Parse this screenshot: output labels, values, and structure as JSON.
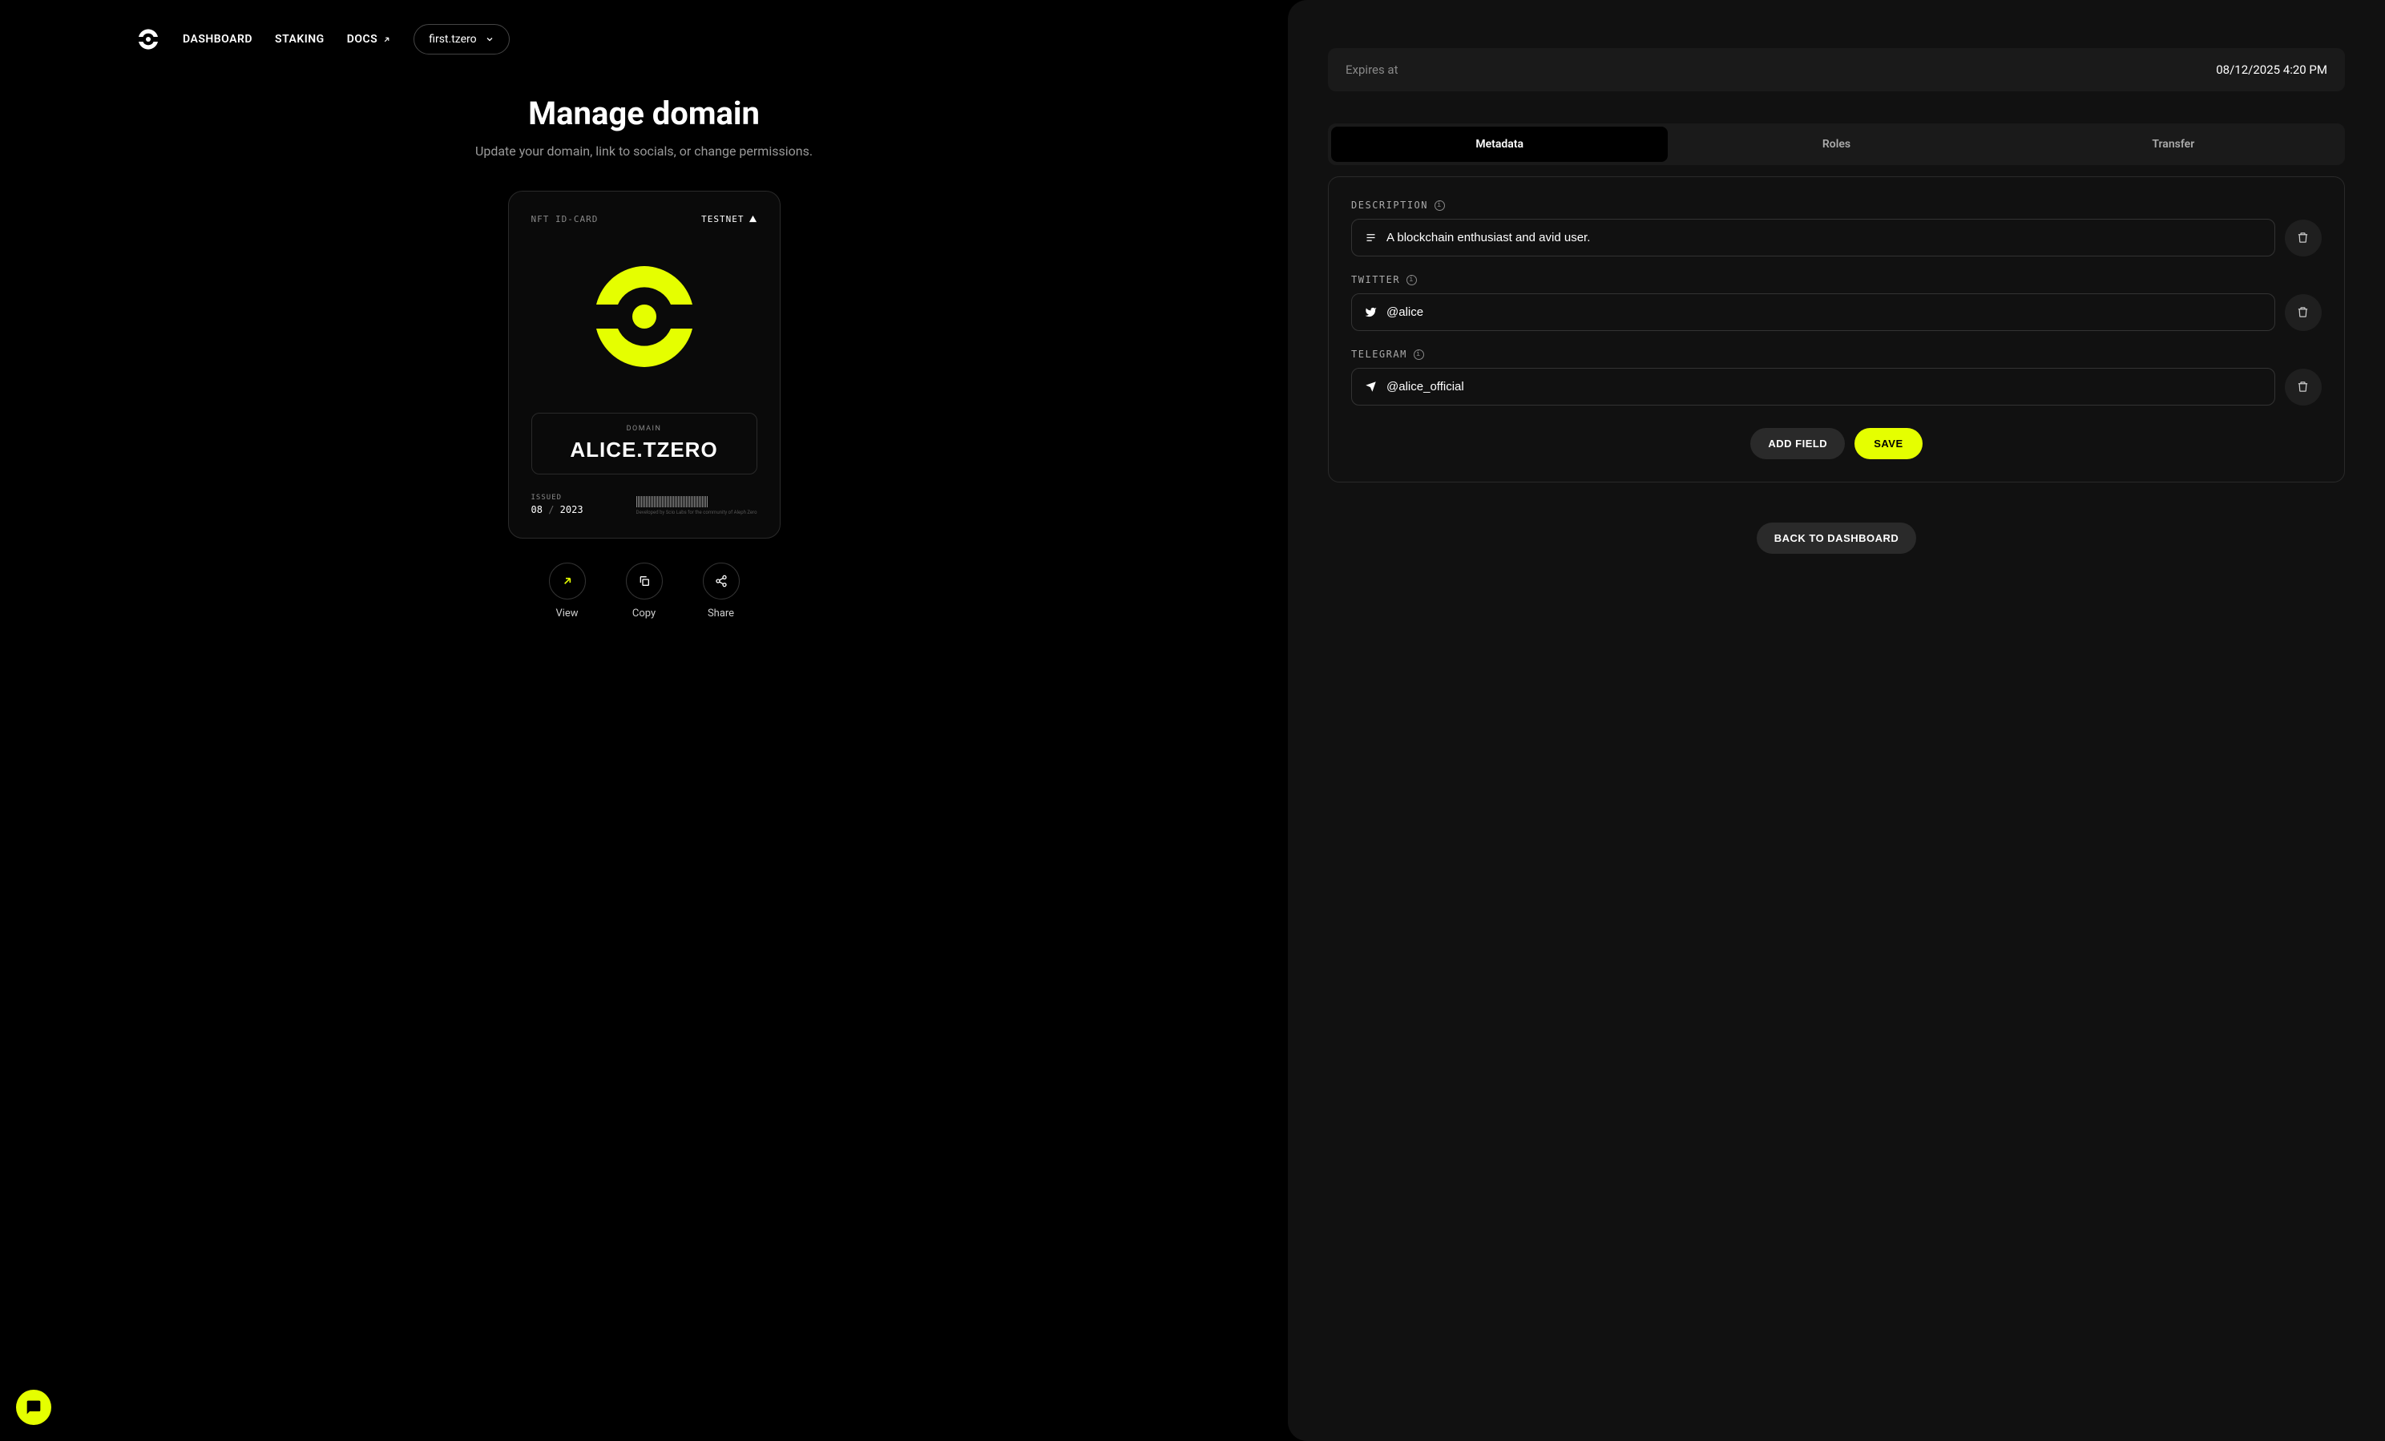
{
  "nav": {
    "dashboard": "DASHBOARD",
    "staking": "STAKING",
    "docs": "DOCS",
    "selected_domain": "first.tzero"
  },
  "page": {
    "title": "Manage domain",
    "subtitle": "Update your domain, link to socials, or change permissions."
  },
  "card": {
    "header_left": "NFT ID-CARD",
    "header_right": "TESTNET",
    "domain_label": "DOMAIN",
    "domain_name": "ALICE.TZERO",
    "issued_label": "ISSUED",
    "issued_month": "08",
    "issued_year": "2023",
    "fine_print": "Developed by Scio Labs for the community of Aleph Zero"
  },
  "actions": {
    "view": "View",
    "copy": "Copy",
    "share": "Share"
  },
  "expires": {
    "label": "Expires at",
    "value": "08/12/2025 4:20 PM"
  },
  "tabs": {
    "metadata": "Metadata",
    "roles": "Roles",
    "transfer": "Transfer"
  },
  "fields": {
    "description": {
      "label": "DESCRIPTION",
      "value": "A blockchain enthusiast and avid user."
    },
    "twitter": {
      "label": "TWITTER",
      "value": "@alice"
    },
    "telegram": {
      "label": "TELEGRAM",
      "value": "@alice_official"
    }
  },
  "buttons": {
    "add_field": "ADD FIELD",
    "save": "SAVE",
    "back": "BACK TO DASHBOARD"
  },
  "colors": {
    "accent": "#e5ff00"
  }
}
